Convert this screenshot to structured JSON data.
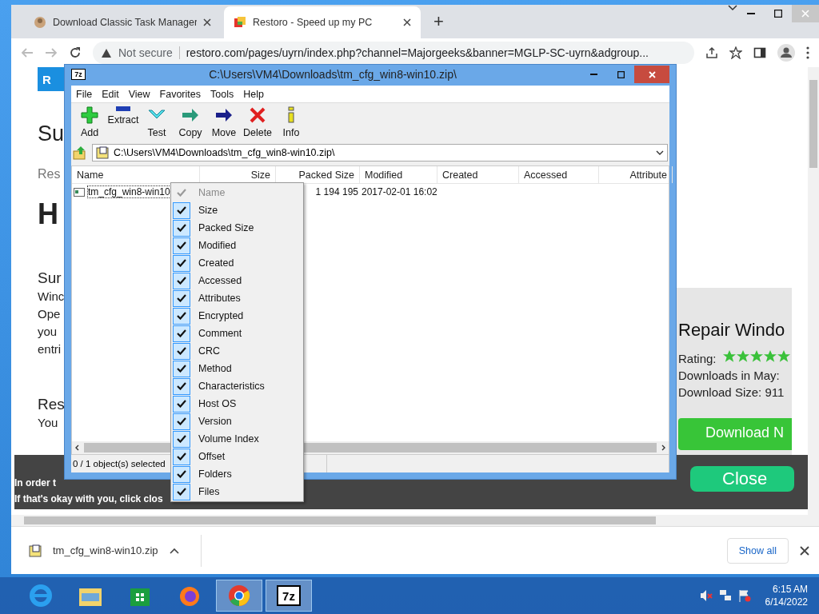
{
  "browser": {
    "tabs": [
      {
        "title": "Download Classic Task Manager",
        "selected": false
      },
      {
        "title": "Restoro - Speed up my PC",
        "selected": true
      }
    ],
    "new_tab": "+",
    "address": {
      "security": "Not secure",
      "url": "restoro.com/pages/uyrn/index.php?channel=Majorgeeks&banner=MGLP-SC-uyrn&adgroup..."
    }
  },
  "webpage": {
    "banner": "R",
    "fragments": [
      {
        "kind": "title",
        "text": "Su"
      },
      {
        "kind": "subtitle",
        "text": "Res"
      },
      {
        "kind": "bold",
        "text": "H"
      },
      {
        "kind": "heading",
        "text": "Sur"
      },
      {
        "kind": "body",
        "text": "Winc"
      },
      {
        "kind": "body",
        "text": "Ope"
      },
      {
        "kind": "body",
        "text": "you"
      },
      {
        "kind": "body",
        "text": "entri"
      },
      {
        "kind": "heading",
        "text": "Res"
      },
      {
        "kind": "body",
        "text": "You"
      }
    ],
    "promo": {
      "title": "Repair Windo",
      "rating_label": "Rating:",
      "stars": 5,
      "downloads": "Downloads in May:",
      "size": "Download Size: 911",
      "download_button": "Download N"
    },
    "cookie": {
      "lines": [
        "In order t",
        "If that's okay with you, click clos"
      ],
      "close": "Close"
    }
  },
  "downloads_bar": {
    "file": "tm_cfg_win8-win10.zip",
    "show_all": "Show all"
  },
  "archiver": {
    "window_icon": "7z",
    "title": "C:\\Users\\VM4\\Downloads\\tm_cfg_win8-win10.zip\\",
    "menu": [
      "File",
      "Edit",
      "View",
      "Favorites",
      "Tools",
      "Help"
    ],
    "toolbar": [
      {
        "kind": "add",
        "label": "Add"
      },
      {
        "kind": "extract",
        "label": "Extract"
      },
      {
        "kind": "test",
        "label": "Test"
      },
      {
        "kind": "copy",
        "label": "Copy"
      },
      {
        "kind": "move",
        "label": "Move"
      },
      {
        "kind": "delete",
        "label": "Delete"
      },
      {
        "kind": "info",
        "label": "Info"
      }
    ],
    "path": "C:\\Users\\VM4\\Downloads\\tm_cfg_win8-win10.zip\\",
    "columns": [
      "Name",
      "Size",
      "Packed Size",
      "Modified",
      "Created",
      "Accessed",
      "Attribute"
    ],
    "rows": [
      {
        "name": "tm_cfg_win8-win10",
        "packed_size": "1 194 195",
        "modified": "2017-02-01 16:02"
      }
    ],
    "status": "0 / 1 object(s) selected"
  },
  "column_menu": [
    {
      "label": "Name",
      "checked": true,
      "disabled": true
    },
    {
      "label": "Size",
      "checked": true,
      "disabled": false
    },
    {
      "label": "Packed Size",
      "checked": true,
      "disabled": false
    },
    {
      "label": "Modified",
      "checked": true,
      "disabled": false
    },
    {
      "label": "Created",
      "checked": true,
      "disabled": false
    },
    {
      "label": "Accessed",
      "checked": true,
      "disabled": false
    },
    {
      "label": "Attributes",
      "checked": true,
      "disabled": false
    },
    {
      "label": "Encrypted",
      "checked": true,
      "disabled": false
    },
    {
      "label": "Comment",
      "checked": true,
      "disabled": false
    },
    {
      "label": "CRC",
      "checked": true,
      "disabled": false
    },
    {
      "label": "Method",
      "checked": true,
      "disabled": false
    },
    {
      "label": "Characteristics",
      "checked": true,
      "disabled": false
    },
    {
      "label": "Host OS",
      "checked": true,
      "disabled": false
    },
    {
      "label": "Version",
      "checked": true,
      "disabled": false
    },
    {
      "label": "Volume Index",
      "checked": true,
      "disabled": false
    },
    {
      "label": "Offset",
      "checked": true,
      "disabled": false
    },
    {
      "label": "Folders",
      "checked": true,
      "disabled": false
    },
    {
      "label": "Files",
      "checked": true,
      "disabled": false
    }
  ],
  "taskbar": {
    "apps": [
      {
        "kind": "ie",
        "selected": false
      },
      {
        "kind": "explorer",
        "selected": false
      },
      {
        "kind": "store",
        "selected": false
      },
      {
        "kind": "firefox",
        "selected": false
      },
      {
        "kind": "chrome",
        "selected": true
      },
      {
        "kind": "sevenzip",
        "selected": true,
        "label": "7z"
      }
    ],
    "time": "6:15 AM",
    "date": "6/14/2022"
  }
}
